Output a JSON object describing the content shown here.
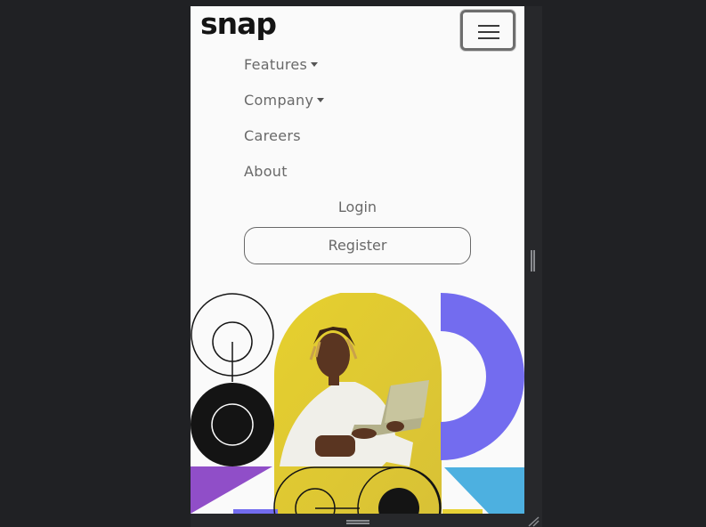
{
  "brand": {
    "logo_text": "snap"
  },
  "menu_toggle": {
    "icon": "hamburger-icon"
  },
  "nav": {
    "items": [
      {
        "label": "Features",
        "has_dropdown": true
      },
      {
        "label": "Company",
        "has_dropdown": true
      },
      {
        "label": "Careers",
        "has_dropdown": false
      },
      {
        "label": "About",
        "has_dropdown": false
      }
    ],
    "login_label": "Login",
    "register_label": "Register"
  },
  "colors": {
    "page_bg": "#fafafa",
    "dark": "#141414",
    "muted_text": "#696969",
    "violet": "#736cef",
    "yellow": "#e8d236",
    "purple": "#904ec8",
    "sky": "#4db0e0"
  }
}
